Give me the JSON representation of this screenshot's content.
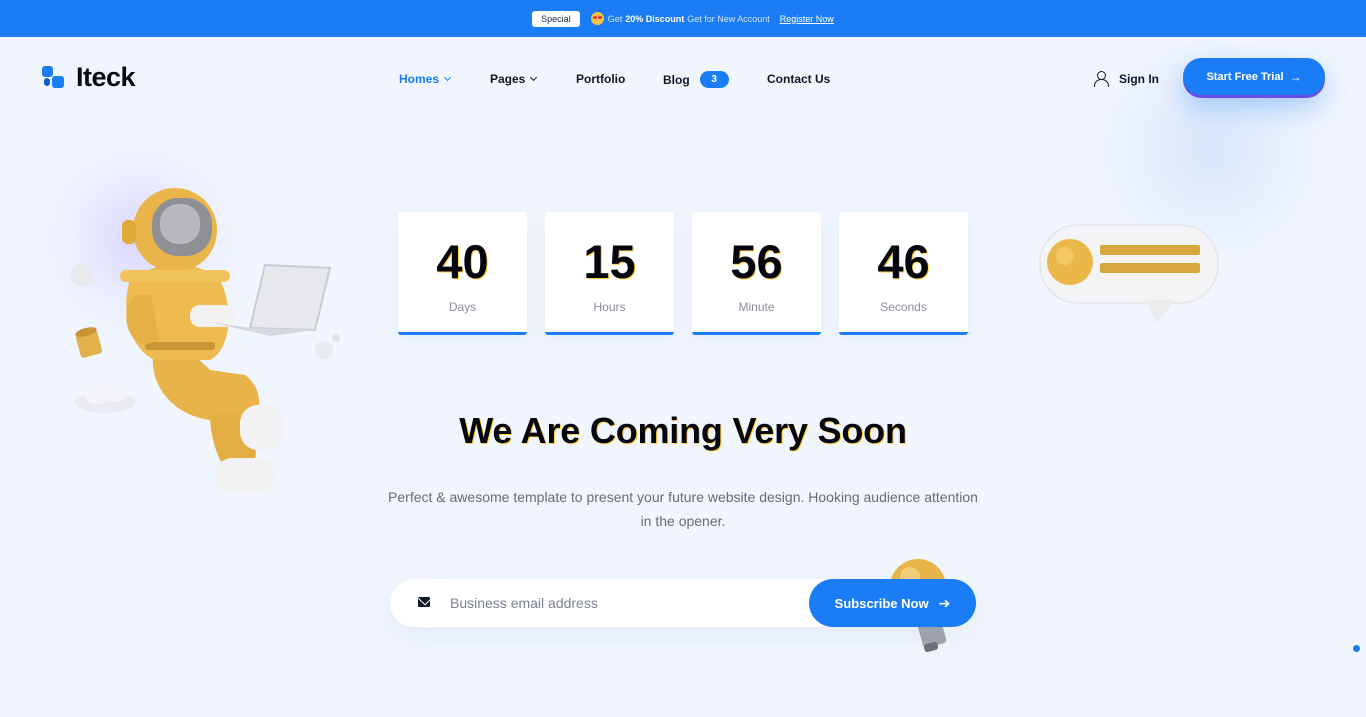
{
  "topbar": {
    "badge": "Special",
    "prefix": "Get",
    "discount": "20% Discount",
    "suffix": "Get for New Account",
    "link": "Register Now"
  },
  "brand": {
    "name": "Iteck",
    "color": "#1b7df6"
  },
  "nav": {
    "items": [
      {
        "label": "Homes",
        "has_dropdown": true,
        "active": true
      },
      {
        "label": "Pages",
        "has_dropdown": true,
        "active": false
      },
      {
        "label": "Portfolio",
        "has_dropdown": false,
        "active": false
      },
      {
        "label": "Blog",
        "badge": "3",
        "active": false
      },
      {
        "label": "Contact Us",
        "has_dropdown": false,
        "active": false
      }
    ]
  },
  "header": {
    "signin_label": "Sign In",
    "signin_icon": "user-icon",
    "cta_label": "Start Free Trial",
    "cta_icon": "arrow-right-icon"
  },
  "countdown": [
    {
      "value": "40",
      "label": "Days"
    },
    {
      "value": "15",
      "label": "Hours"
    },
    {
      "value": "56",
      "label": "Minute"
    },
    {
      "value": "46",
      "label": "Seconds"
    }
  ],
  "hero": {
    "title": "We Are Coming Very Soon",
    "description": "Perfect & awesome template to present your future website design. Hooking audience attention in the opener."
  },
  "subscribe": {
    "placeholder": "Business email address",
    "value": "",
    "button_label": "Subscribe Now",
    "input_icon": "envelope-icon",
    "button_icon": "arrow-right-icon"
  },
  "colors": {
    "accent": "#1b7df6",
    "background": "#f1f6fe",
    "highlight": "#ffcf3a"
  }
}
